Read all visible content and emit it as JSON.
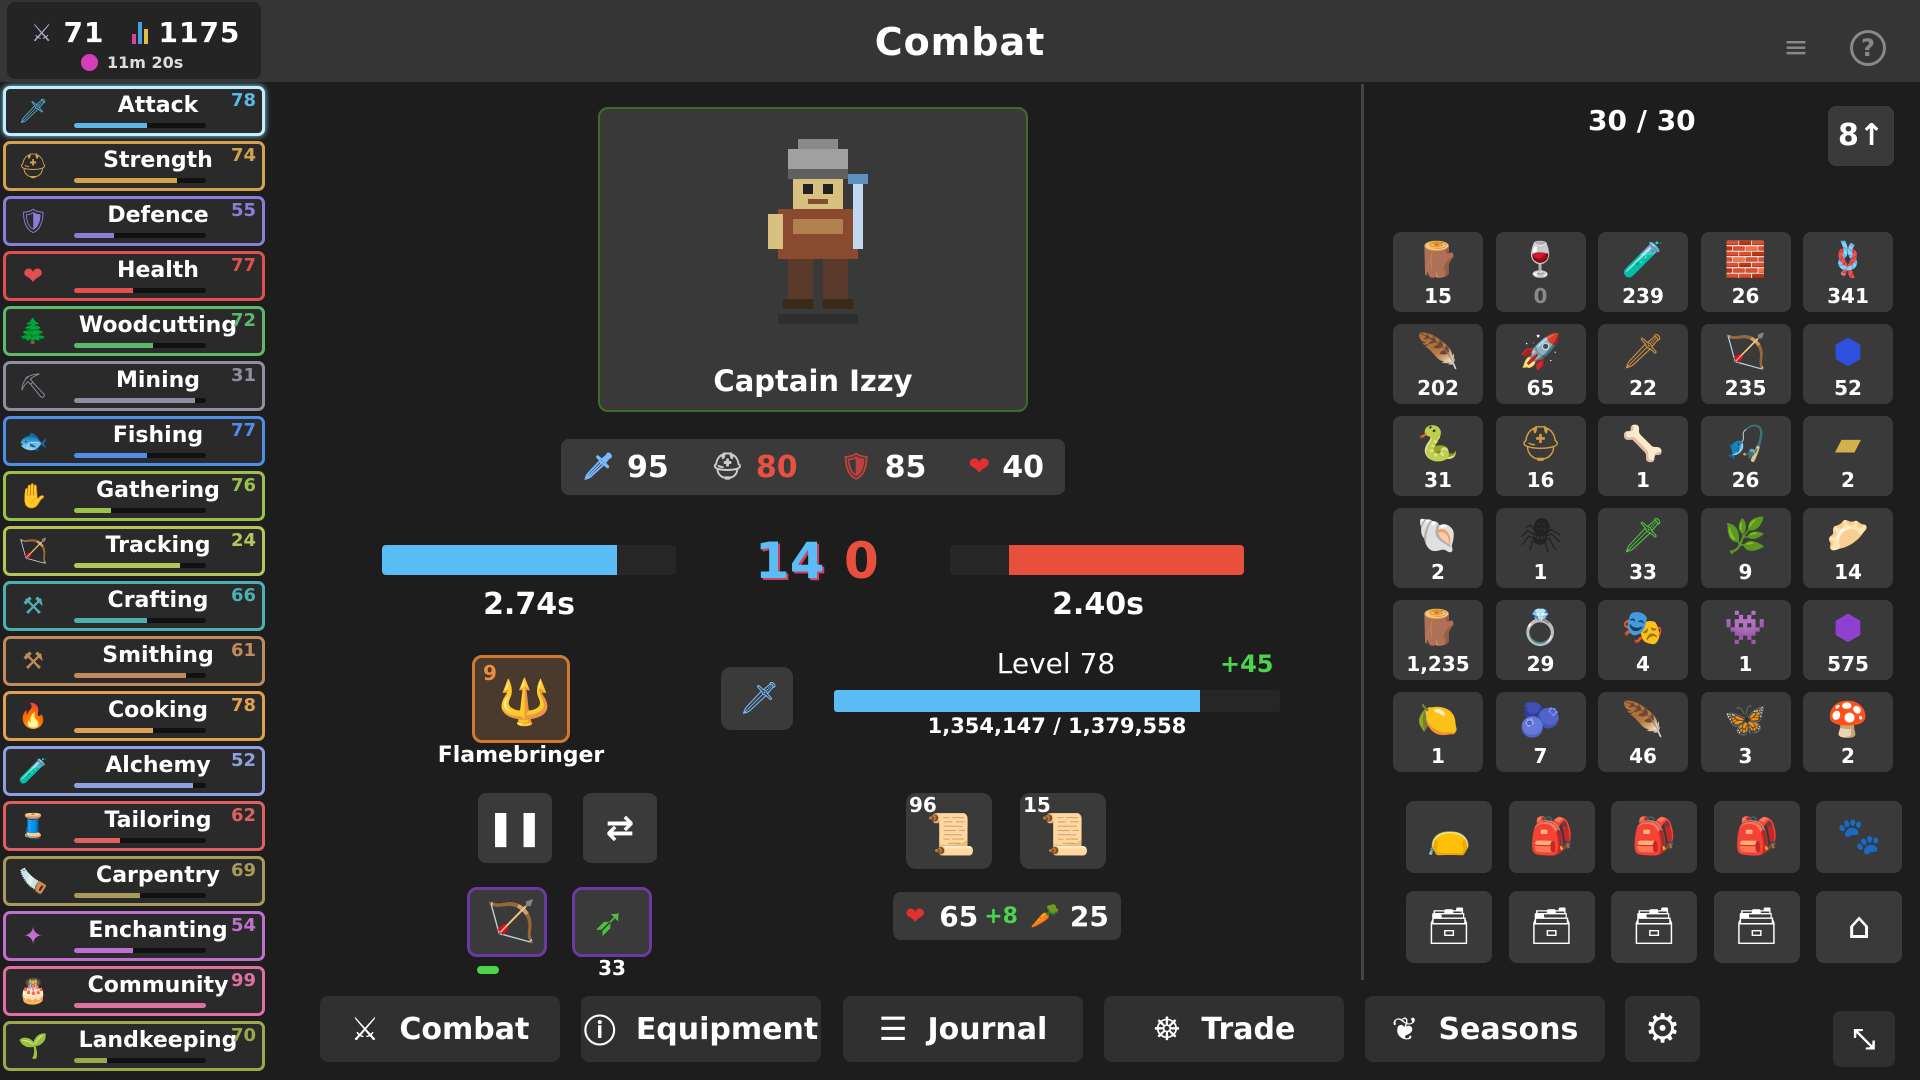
{
  "header": {
    "swords": "71",
    "total_level": "1175",
    "timer": "11m 20s",
    "title": "Combat"
  },
  "skills": [
    {
      "name": "Attack",
      "level": "78",
      "icon": "sword-icon",
      "glyph": "🗡",
      "color": "#58b8e6",
      "fill": 0.55,
      "sel": true
    },
    {
      "name": "Strength",
      "level": "74",
      "icon": "helmet-icon",
      "glyph": "⛑",
      "color": "#d4a24a",
      "fill": 0.78
    },
    {
      "name": "Defence",
      "level": "55",
      "icon": "shield-icon",
      "glyph": "🛡",
      "color": "#8a7fd8",
      "fill": 0.3
    },
    {
      "name": "Health",
      "level": "77",
      "icon": "heart-icon",
      "glyph": "❤",
      "color": "#e05050",
      "fill": 0.45
    },
    {
      "name": "Woodcutting",
      "level": "72",
      "icon": "tree-icon",
      "glyph": "🌲",
      "color": "#5db86a",
      "fill": 0.6
    },
    {
      "name": "Mining",
      "level": "31",
      "icon": "pickaxe-icon",
      "glyph": "⛏",
      "color": "#8e8ea0",
      "fill": 0.92
    },
    {
      "name": "Fishing",
      "level": "77",
      "icon": "fish-icon",
      "glyph": "🐟",
      "color": "#4f8ee8",
      "fill": 0.55
    },
    {
      "name": "Gathering",
      "level": "76",
      "icon": "hand-icon",
      "glyph": "✋",
      "color": "#9ac24a",
      "fill": 0.28
    },
    {
      "name": "Tracking",
      "level": "24",
      "icon": "bow-icon",
      "glyph": "🏹",
      "color": "#b6c55a",
      "fill": 0.8
    },
    {
      "name": "Crafting",
      "level": "66",
      "icon": "tools-icon",
      "glyph": "⚒",
      "color": "#4bb0b0",
      "fill": 0.55
    },
    {
      "name": "Smithing",
      "level": "61",
      "icon": "anvil-icon",
      "glyph": "⚒",
      "color": "#c08a5a",
      "fill": 0.85
    },
    {
      "name": "Cooking",
      "level": "78",
      "icon": "fire-icon",
      "glyph": "🔥",
      "color": "#e0a050",
      "fill": 0.6
    },
    {
      "name": "Alchemy",
      "level": "52",
      "icon": "vial-icon",
      "glyph": "🧪",
      "color": "#8fa0e0",
      "fill": 0.9
    },
    {
      "name": "Tailoring",
      "level": "62",
      "icon": "needle-icon",
      "glyph": "🧵",
      "color": "#e06060",
      "fill": 0.35
    },
    {
      "name": "Carpentry",
      "level": "69",
      "icon": "saw-icon",
      "glyph": "🪚",
      "color": "#a89a5a",
      "fill": 0.5
    },
    {
      "name": "Enchanting",
      "level": "54",
      "icon": "star-icon",
      "glyph": "✦",
      "color": "#c070d0",
      "fill": 0.45
    },
    {
      "name": "Community",
      "level": "99",
      "icon": "cake-icon",
      "glyph": "🎂",
      "color": "#e070a0",
      "fill": 1.0
    },
    {
      "name": "Landkeeping",
      "level": "70",
      "icon": "sprout-icon",
      "glyph": "🌱",
      "color": "#9aa84a",
      "fill": 0.25
    }
  ],
  "enemy": {
    "name": "Captain Izzy",
    "attack": "95",
    "strength": "80",
    "defence": "85",
    "health": "40"
  },
  "combat": {
    "player_timer": "2.74s",
    "enemy_timer": "2.40s",
    "player_score": "14",
    "enemy_score": "0",
    "player_progress": 0.8,
    "enemy_progress": 0.8
  },
  "weapon": {
    "name": "Flamebringer",
    "count": "9"
  },
  "level": {
    "label": "Level 78",
    "gain": "+45",
    "xp_text": "1,354,147 / 1,379,558",
    "progress": 0.82
  },
  "scrolls": [
    {
      "count": "96"
    },
    {
      "count": "15"
    }
  ],
  "quiver": {
    "count": "33"
  },
  "food": {
    "hp": "65",
    "bonus": "+8",
    "food_count": "25"
  },
  "inventory": {
    "capacity": "30 / 30",
    "items": [
      {
        "q": "15",
        "g": "🪵",
        "c": "#8a5a3a"
      },
      {
        "q": "0",
        "g": "🍷",
        "c": "#7a3a6a"
      },
      {
        "q": "239",
        "g": "🧪",
        "c": "#c0a0e0"
      },
      {
        "q": "26",
        "g": "🧱",
        "c": "#c03030"
      },
      {
        "q": "341",
        "g": "🪢",
        "c": "#c08a3a"
      },
      {
        "q": "202",
        "g": "🪶",
        "c": "#ccccdd"
      },
      {
        "q": "65",
        "g": "🚀",
        "c": "#d04040"
      },
      {
        "q": "22",
        "g": "🗡",
        "c": "#d09040"
      },
      {
        "q": "235",
        "g": "🏹",
        "c": "#c09040"
      },
      {
        "q": "52",
        "g": "⬢",
        "c": "#3050e0"
      },
      {
        "q": "31",
        "g": "🐍",
        "c": "#c08a3a"
      },
      {
        "q": "16",
        "g": "⛑",
        "c": "#d0a040"
      },
      {
        "q": "1",
        "g": "🦴",
        "c": "#eeeeee"
      },
      {
        "q": "26",
        "g": "🎣",
        "c": "#6080e0"
      },
      {
        "q": "2",
        "g": "▰",
        "c": "#d4b04a"
      },
      {
        "q": "2",
        "g": "🐚",
        "c": "#e0b0a0"
      },
      {
        "q": "1",
        "g": "🕷",
        "c": "#222222"
      },
      {
        "q": "33",
        "g": "🗡",
        "c": "#50c040"
      },
      {
        "q": "9",
        "g": "🌿",
        "c": "#3a8a6a"
      },
      {
        "q": "14",
        "g": "🥟",
        "c": "#c09050"
      },
      {
        "q": "1,235",
        "g": "🪵",
        "c": "#9a6a3a"
      },
      {
        "q": "29",
        "g": "💍",
        "c": "#8060e0"
      },
      {
        "q": "4",
        "g": "🎭",
        "c": "#80b0e0"
      },
      {
        "q": "1",
        "g": "👾",
        "c": "#8040c0"
      },
      {
        "q": "575",
        "g": "⬢",
        "c": "#9040d0"
      },
      {
        "q": "1",
        "g": "🍋",
        "c": "#e0d040"
      },
      {
        "q": "7",
        "g": "🫐",
        "c": "#304080"
      },
      {
        "q": "46",
        "g": "🪶",
        "c": "#c0d0c0"
      },
      {
        "q": "3",
        "g": "🦋",
        "c": "#4080e0"
      },
      {
        "q": "2",
        "g": "🍄",
        "c": "#d03030"
      }
    ]
  },
  "bank": {
    "row1": [
      "bag-red-icon",
      "bag-green-icon",
      "bag-green-icon",
      "bag-green-icon",
      "paw-icon"
    ],
    "row2": [
      "chest-icon",
      "chest-icon",
      "chest-icon",
      "chest-dark-icon",
      "home-icon"
    ]
  },
  "nav": {
    "combat": "Combat",
    "equipment": "Equipment",
    "journal": "Journal",
    "trade": "Trade",
    "seasons": "Seasons"
  }
}
